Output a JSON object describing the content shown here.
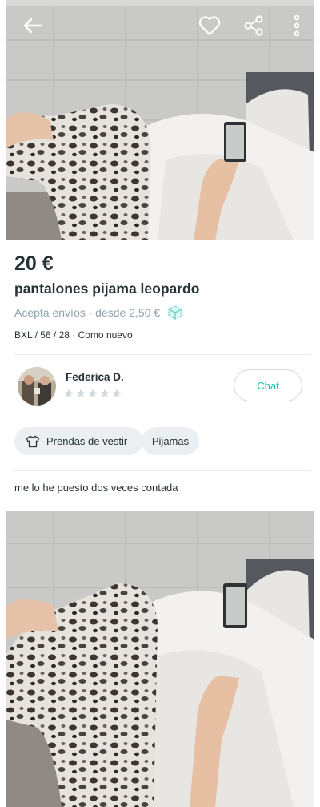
{
  "header": {
    "icons": [
      "back-arrow-icon",
      "heart-icon",
      "share-icon",
      "more-vertical-icon"
    ]
  },
  "listing": {
    "price": "20 €",
    "title": "pantalones pijama leopardo",
    "shipping_text": "Acepta envíos · desde 2,50 €",
    "details": "BXL / 56 / 28 · Como nuevo",
    "description": "me lo he puesto dos veces contada"
  },
  "seller": {
    "name": "Federica D.",
    "rating_stars_filled": 0,
    "rating_stars_total": 5
  },
  "chat_button": "Chat",
  "chips": [
    {
      "label": "Prendas de vestir",
      "icon": "shirt-icon"
    },
    {
      "label": "Pijamas"
    }
  ],
  "colors": {
    "accent": "#13c1ac",
    "text": "#253238",
    "muted": "#90a4ae",
    "chip_bg": "#eceff1",
    "star_empty": "#cfd8dc"
  }
}
